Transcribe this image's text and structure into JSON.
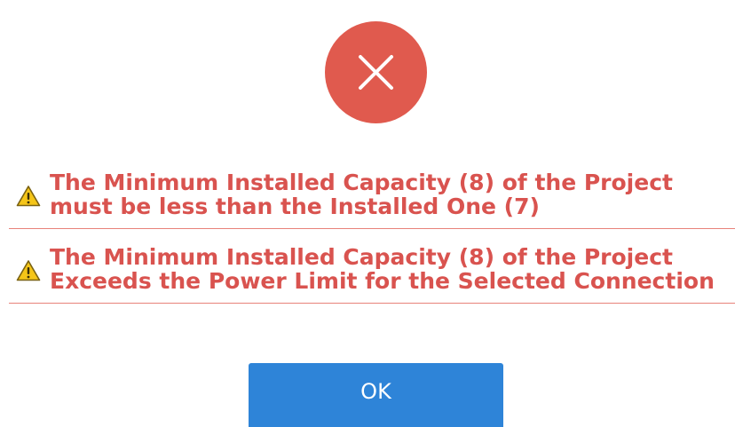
{
  "dialog": {
    "status_icon": "error-x-icon",
    "colors": {
      "error_circle": "#e05a4e",
      "message_text": "#d9534f",
      "divider": "#e8827a",
      "ok_button": "#2e84d8",
      "warning_icon_fill": "#f5c518"
    },
    "messages": [
      {
        "icon": "warning-icon",
        "line1": "The Minimum Installed Capacity (8) of the Project",
        "line2": "must be less than the Installed One (7)"
      },
      {
        "icon": "warning-icon",
        "line1": "The Minimum Installed Capacity (8) of the Project",
        "line2": "Exceeds the Power Limit for the Selected Connection"
      }
    ],
    "ok_label": "OK"
  }
}
